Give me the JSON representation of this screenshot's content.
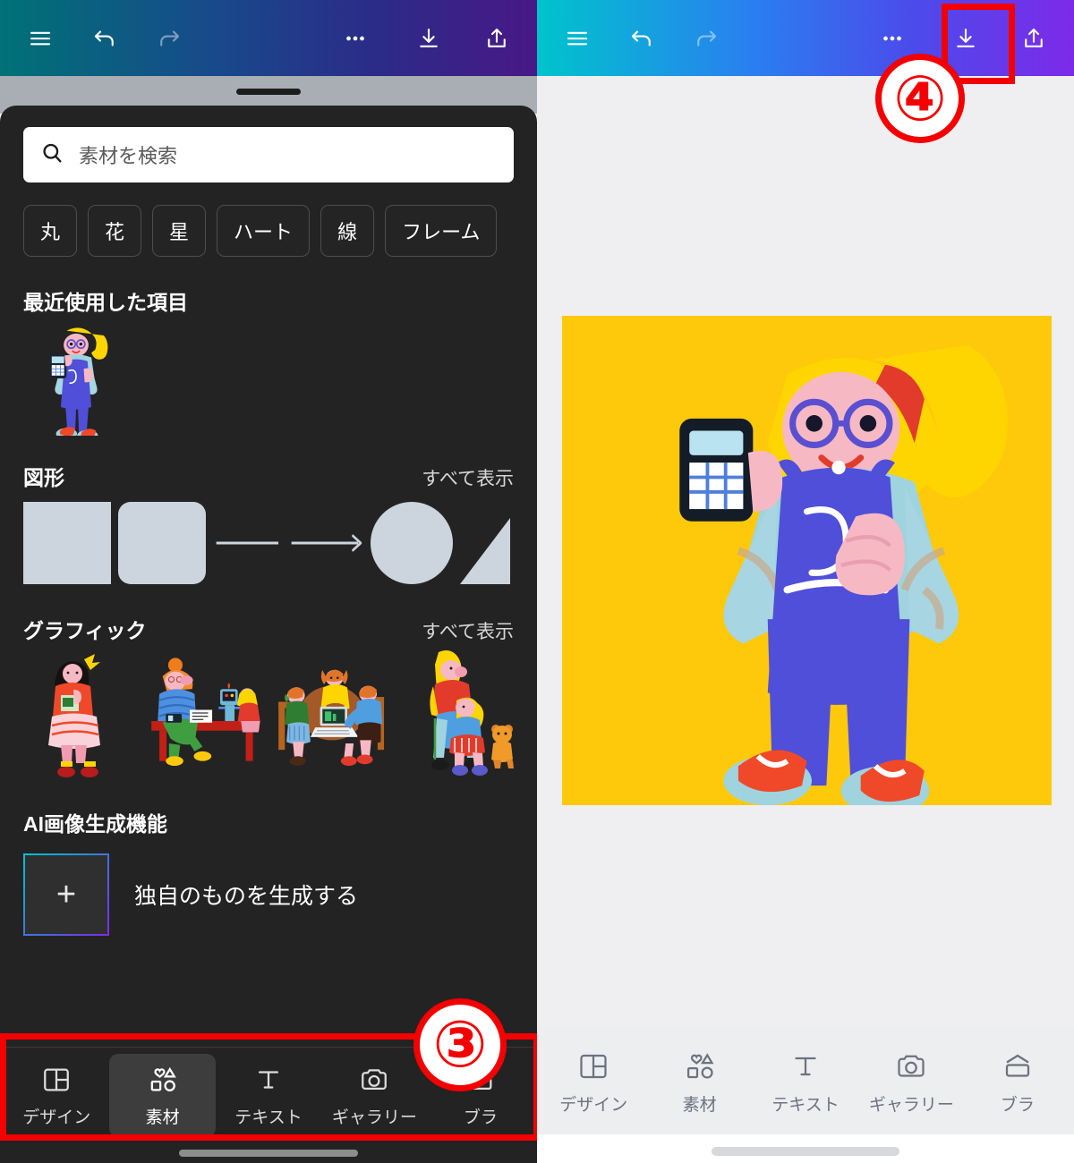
{
  "colors": {
    "gradient_start": "#00c4cc",
    "gradient_mid": "#2a7ff0",
    "gradient_end": "#7d2ae8",
    "sheet_bg": "#232323",
    "canvas_bg": "#efeff1",
    "artboard_bg": "#ffc90b",
    "annotation_red": "#f40000",
    "shape_gray": "#ccd4dd"
  },
  "left_phone": {
    "appbar": {
      "menu_icon": "hamburger-menu-icon",
      "undo_icon": "undo-icon",
      "redo_icon": "redo-icon",
      "more_icon": "more-horizontal-icon",
      "download_icon": "download-icon",
      "share_icon": "share-icon"
    },
    "search": {
      "icon": "search-icon",
      "placeholder": "素材を検索",
      "value": ""
    },
    "chips": [
      {
        "label": "丸"
      },
      {
        "label": "花"
      },
      {
        "label": "星"
      },
      {
        "label": "ハート"
      },
      {
        "label": "線"
      },
      {
        "label": "フレーム"
      }
    ],
    "sections": [
      {
        "title": "最近使用した項目",
        "see_all": ""
      },
      {
        "title": "図形",
        "see_all": "すべて表示"
      },
      {
        "title": "グラフィック",
        "see_all": "すべて表示"
      },
      {
        "title": "AI画像生成機能",
        "see_all": ""
      }
    ],
    "ai": {
      "plus_icon": "plus-icon",
      "label": "独自のものを生成する"
    },
    "bottom_nav": {
      "active_index": 1,
      "items": [
        {
          "label": "デザイン",
          "icon": "layout-panels-icon"
        },
        {
          "label": "素材",
          "icon": "shapes-icon"
        },
        {
          "label": "テキスト",
          "icon": "text-t-icon"
        },
        {
          "label": "ギャラリー",
          "icon": "camera-icon"
        },
        {
          "label": "ブラ",
          "icon": "brand-icon"
        }
      ]
    }
  },
  "right_phone": {
    "appbar": {
      "menu_icon": "hamburger-menu-icon",
      "undo_icon": "undo-icon",
      "redo_icon": "redo-icon",
      "more_icon": "more-horizontal-icon",
      "download_icon": "download-icon",
      "share_icon": "share-icon"
    },
    "artboard": {
      "background_color": "#ffc90b",
      "artwork": "girl-with-calculator-illustration"
    },
    "bottom_nav": {
      "active_index": -1,
      "items": [
        {
          "label": "デザイン",
          "icon": "layout-panels-icon"
        },
        {
          "label": "素材",
          "icon": "shapes-icon"
        },
        {
          "label": "テキスト",
          "icon": "text-t-icon"
        },
        {
          "label": "ギャラリー",
          "icon": "camera-icon"
        },
        {
          "label": "ブラ",
          "icon": "brand-icon"
        }
      ]
    }
  },
  "annotations": [
    {
      "badge": "③",
      "target": "bottom-nav-left"
    },
    {
      "badge": "④",
      "target": "download-button-right"
    }
  ]
}
